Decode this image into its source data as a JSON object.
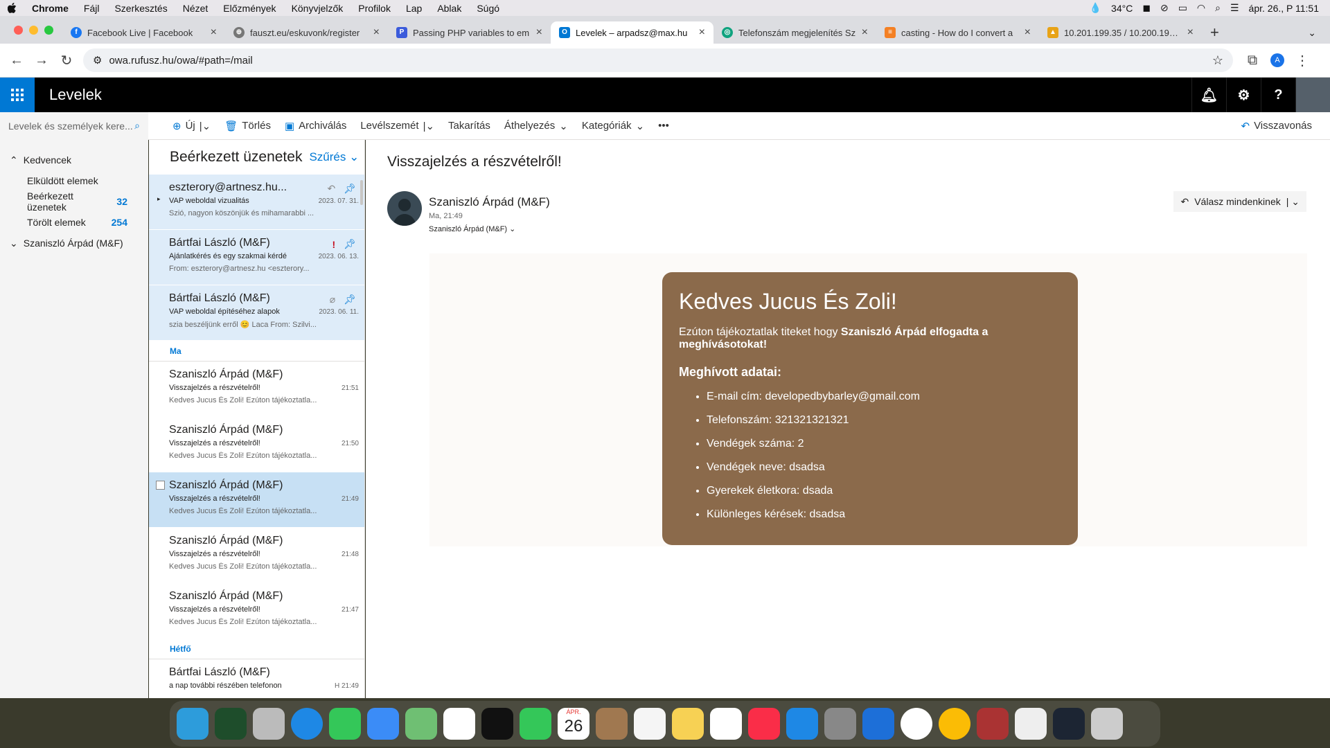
{
  "menubar": {
    "apple": "",
    "app": "Chrome",
    "items": [
      "Fájl",
      "Szerkesztés",
      "Nézet",
      "Előzmények",
      "Könyvjelzők",
      "Profilok",
      "Lap",
      "Ablak",
      "Súgó"
    ],
    "temp": "34°C",
    "datetime": "ápr. 26., P 11:51"
  },
  "tabs": [
    {
      "title": "Facebook Live | Facebook",
      "color": "#1877f2",
      "glyph": "f"
    },
    {
      "title": "fauszt.eu/eskuvonk/register",
      "color": "#777",
      "glyph": "⊕"
    },
    {
      "title": "Passing PHP variables to em",
      "color": "#3b5bdb",
      "glyph": "P"
    },
    {
      "title": "Levelek – arpadsz@max.hu",
      "color": "#0078d4",
      "glyph": "O"
    },
    {
      "title": "Telefonszám megjelenítés Sz",
      "color": "#10a37f",
      "glyph": "◎"
    },
    {
      "title": "casting - How do I convert a",
      "color": "#f48024",
      "glyph": "≡"
    },
    {
      "title": "10.201.199.35 / 10.200.199.3",
      "color": "#e8a317",
      "glyph": "▲"
    }
  ],
  "url": "owa.rufusz.hu/owa/#path=/mail",
  "profile_letter": "A",
  "owa": {
    "title": "Levelek"
  },
  "search_placeholder": "Levelek és személyek kere...",
  "commands": {
    "new": "Új",
    "delete": "Törlés",
    "archive": "Archiválás",
    "junk": "Levélszemét",
    "sweep": "Takarítás",
    "move": "Áthelyezés",
    "categories": "Kategóriák",
    "more": "•••",
    "undo": "Visszavonás"
  },
  "leftnav": {
    "favorites": "Kedvencek",
    "sent": "Elküldött elemek",
    "inbox": "Beérkezett üzenetek",
    "inbox_count": "32",
    "deleted": "Törölt elemek",
    "deleted_count": "254",
    "account": "Szaniszló Árpád (M&F)"
  },
  "list": {
    "header": "Beérkezett üzenetek",
    "filter": "Szűrés",
    "pinned": [
      {
        "from": "eszterory@artnesz.hu...",
        "subject": "VAP weboldal vizualitás",
        "date": "2023. 07. 31.",
        "preview": "Szió, nagyon köszönjük és mihamarabbi ..."
      },
      {
        "from": "Bártfai László (M&F)",
        "subject": "Ajánlatkérés és egy szakmai kérdé",
        "date": "2023. 06. 13.",
        "preview": "From: eszterory@artnesz.hu <eszterory..."
      },
      {
        "from": "Bártfai László (M&F)",
        "subject": "VAP weboldal építéséhez alapok",
        "date": "2023. 06. 11.",
        "preview": "szia beszéljünk erről 😊 Laca From: Szilvi..."
      }
    ],
    "section_today": "Ma",
    "today": [
      {
        "from": "Szaniszló Árpád (M&F)",
        "subject": "Visszajelzés a részvételről!",
        "date": "21:51",
        "preview": "Kedves Jucus És Zoli! Ezúton tájékoztatla..."
      },
      {
        "from": "Szaniszló Árpád (M&F)",
        "subject": "Visszajelzés a részvételről!",
        "date": "21:50",
        "preview": "Kedves Jucus És Zoli! Ezúton tájékoztatla..."
      },
      {
        "from": "Szaniszló Árpád (M&F)",
        "subject": "Visszajelzés a részvételről!",
        "date": "21:49",
        "preview": "Kedves Jucus És Zoli! Ezúton tájékoztatla..."
      },
      {
        "from": "Szaniszló Árpád (M&F)",
        "subject": "Visszajelzés a részvételről!",
        "date": "21:48",
        "preview": "Kedves Jucus És Zoli! Ezúton tájékoztatla..."
      },
      {
        "from": "Szaniszló Árpád (M&F)",
        "subject": "Visszajelzés a részvételről!",
        "date": "21:47",
        "preview": "Kedves Jucus És Zoli! Ezúton tájékoztatla..."
      }
    ],
    "section_monday": "Hétfő",
    "monday": [
      {
        "from": "Bártfai László (M&F)",
        "subject": "a nap további részében telefonon",
        "date": "H 21:49",
        "preview": ""
      }
    ]
  },
  "reading": {
    "subject": "Visszajelzés a részvételről!",
    "from": "Szaniszló Árpád (M&F)",
    "time": "Ma, 21:49",
    "to": "Szaniszló Árpád (M&F)",
    "reply_all": "Válasz mindenkinek",
    "card": {
      "heading": "Kedves Jucus És Zoli!",
      "intro": "Ezúton tájékoztatlak titeket hogy ",
      "intro_bold": "Szaniszló Árpád elfogadta a meghívásotokat!",
      "details_title": "Meghívott adatai:",
      "items": [
        "E-mail cím: developedbybarley@gmail.com",
        "Telefonszám: 321321321321",
        "Vendégek száma: 2",
        "Vendégek neve: dsadsa",
        "Gyerekek életkora: dsada",
        "Különleges kérések: dsadsa"
      ]
    }
  },
  "dock": {
    "calendar_month": "ÁPR.",
    "calendar_day": "26"
  }
}
